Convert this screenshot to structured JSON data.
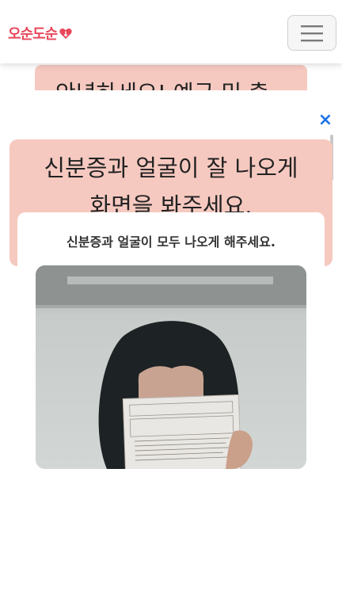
{
  "header": {
    "logo_text": "오순도순",
    "menu_icon": "hamburger-icon"
  },
  "background": {
    "banner_text": "안녕하세요! 예금 및 출"
  },
  "sheet": {
    "close_label": "×",
    "instruction_line1": "신분증과 얼굴이 잘 나오게",
    "instruction_line2": "화면을 봐주세요.",
    "card_title": "신분증과 얼굴이 모두 나오게 해주세요."
  },
  "colors": {
    "brand": "#e8475b",
    "banner": "#f6c9c0",
    "close": "#1a73e8"
  }
}
